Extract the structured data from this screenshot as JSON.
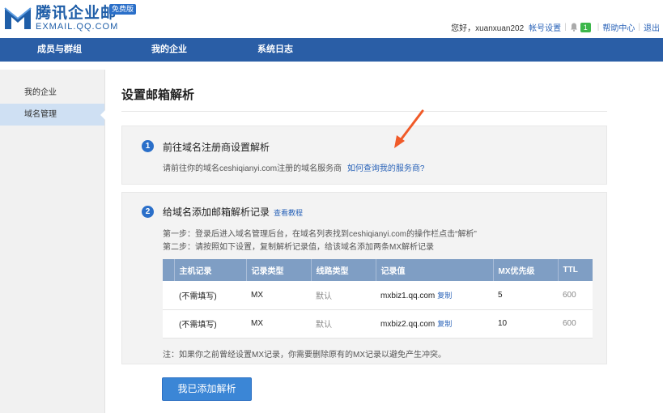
{
  "header": {
    "logo_cn": "腾讯企业邮",
    "logo_en": "EXMAIL.QQ.COM",
    "edition_badge": "免费版",
    "greeting": "您好，xuanxuan202",
    "account_settings": "帐号设置",
    "notification_count": "1",
    "help_center": "帮助中心",
    "logout": "退出"
  },
  "nav": {
    "items": [
      {
        "label": "成员与群组"
      },
      {
        "label": "我的企业"
      },
      {
        "label": "系统日志"
      }
    ]
  },
  "sidebar": {
    "items": [
      {
        "label": "我的企业",
        "active": false
      },
      {
        "label": "域名管理",
        "active": true
      }
    ]
  },
  "main": {
    "title": "设置邮箱解析",
    "step1": {
      "num": "1",
      "title": "前往域名注册商设置解析",
      "desc": "请前往你的域名ceshiqianyi.com注册的域名服务商",
      "link": "如何查询我的服务商?"
    },
    "step2": {
      "num": "2",
      "title": "给域名添加邮箱解析记录",
      "tutorial_link": "查看教程",
      "line1": "第一步：登录后进入域名管理后台，在域名列表找到ceshiqianyi.com的操作栏点击“解析”",
      "line2": "第二步：请按照如下设置，复制解析记录值，给该域名添加两条MX解析记录",
      "table": {
        "headers": [
          "主机记录",
          "记录类型",
          "线路类型",
          "记录值",
          "MX优先级",
          "TTL"
        ],
        "rows": [
          {
            "host": "(不需填写)",
            "type": "MX",
            "line": "默认",
            "value": "mxbiz1.qq.com",
            "copy": "复制",
            "priority": "5",
            "ttl": "600"
          },
          {
            "host": "(不需填写)",
            "type": "MX",
            "line": "默认",
            "value": "mxbiz2.qq.com",
            "copy": "复制",
            "priority": "10",
            "ttl": "600"
          }
        ]
      },
      "note": "注：如果你之前曾经设置MX记录，你需要删除原有的MX记录以避免产生冲突。"
    },
    "confirm_button": "我已添加解析"
  },
  "colors": {
    "nav_bg": "#2a5ea6",
    "table_header": "#7f9ec4",
    "accent_blue": "#2a6fc9",
    "annotation_arrow": "#f05a28"
  }
}
